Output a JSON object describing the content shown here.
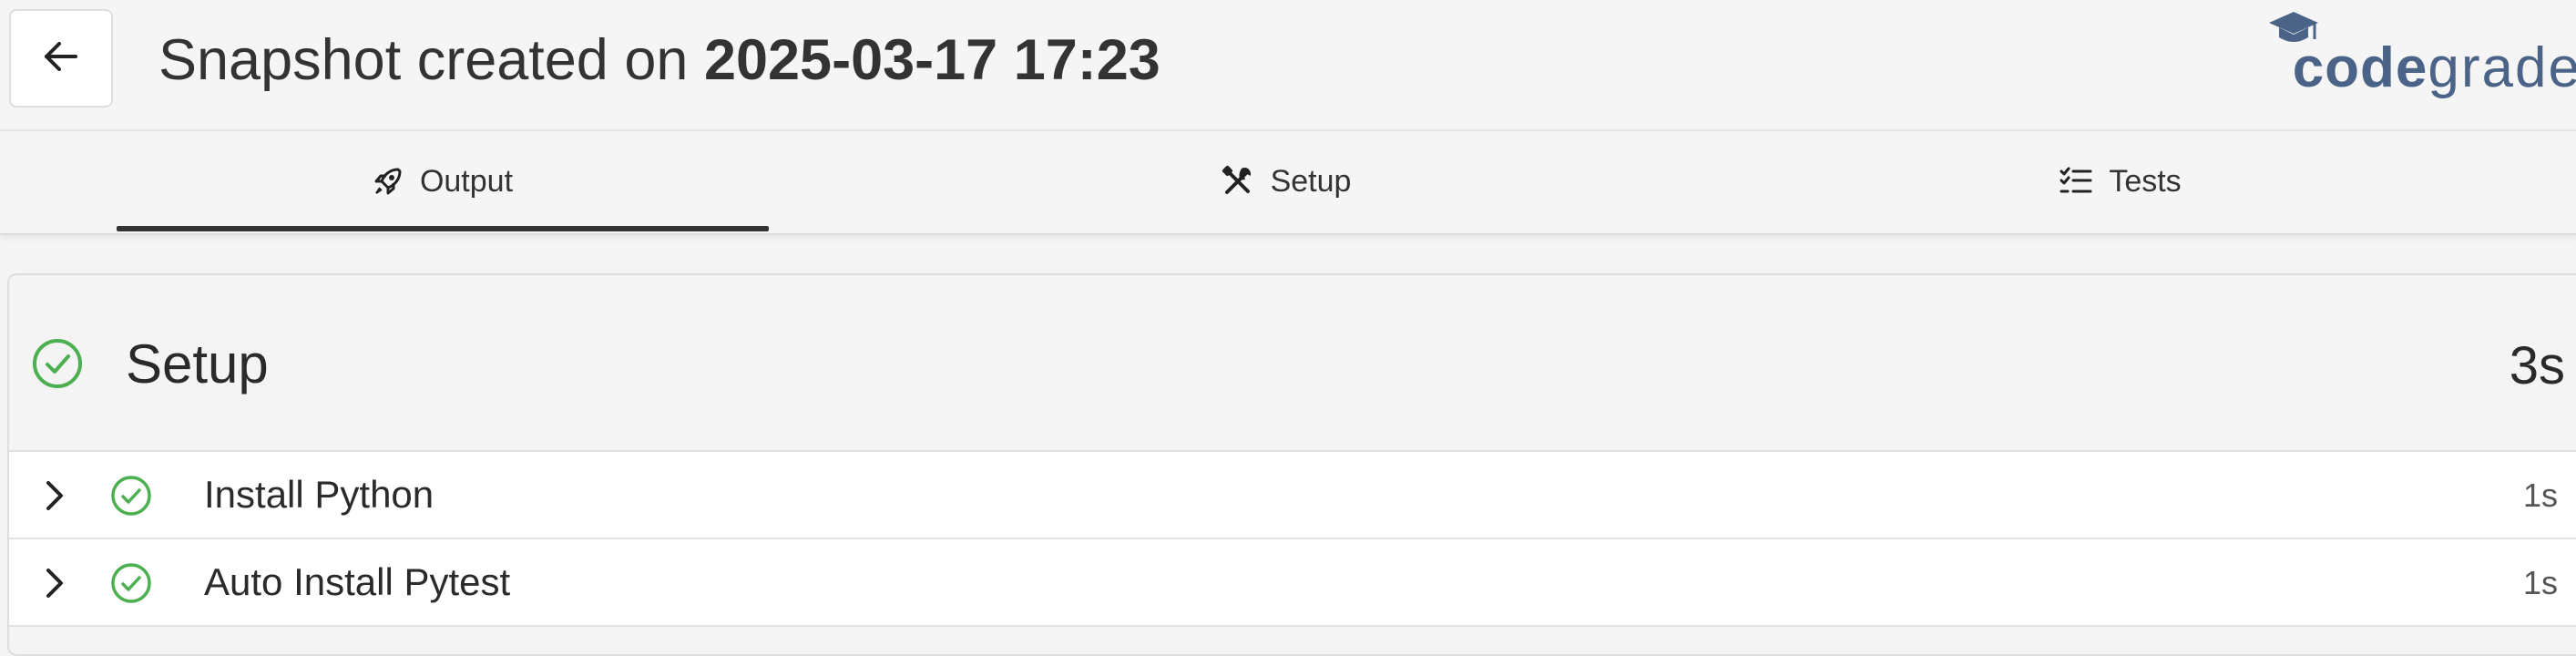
{
  "header": {
    "back_icon": "arrow-left-icon",
    "title_prefix": "Snapshot created on ",
    "title_date": "2025-03-17 17:23",
    "logo_code": "code",
    "logo_grade": "grade",
    "logo_icon": "graduation-cap-icon"
  },
  "tabs": [
    {
      "label": "Output",
      "icon": "rocket-icon",
      "active": true
    },
    {
      "label": "Setup",
      "icon": "tools-icon",
      "active": false
    },
    {
      "label": "Tests",
      "icon": "checklist-icon",
      "active": false
    }
  ],
  "setup_panel": {
    "title": "Setup",
    "duration": "3s",
    "status_icon": "check-circle-icon",
    "steps": [
      {
        "label": "Install Python",
        "duration": "1s",
        "status_icon": "check-circle-icon"
      },
      {
        "label": "Auto Install Pytest",
        "duration": "1s",
        "status_icon": "check-circle-icon"
      }
    ]
  },
  "colors": {
    "success": "#4caf50",
    "logo": "#4a6387",
    "active_tab_underline": "#333333"
  }
}
